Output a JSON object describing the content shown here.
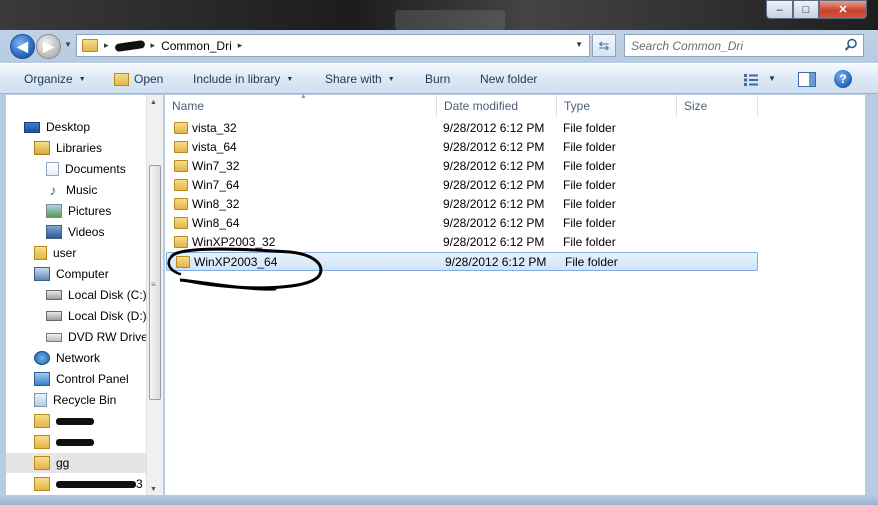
{
  "window": {
    "controls": {
      "minimize": "–",
      "maximize": "□",
      "close": "✕"
    }
  },
  "address": {
    "path_current": "Common_Dri",
    "separator": "▸"
  },
  "search": {
    "placeholder": "Search Common_Dri"
  },
  "toolbar": {
    "organize": "Organize",
    "open": "Open",
    "include_in_library": "Include in library",
    "share_with": "Share with",
    "burn": "Burn",
    "new_folder": "New folder",
    "help": "?"
  },
  "sidebar": {
    "items": [
      {
        "label": "Desktop",
        "icon": "desktop-icon"
      },
      {
        "label": "Libraries",
        "icon": "libraries-icon"
      },
      {
        "label": "Documents",
        "icon": "documents-icon"
      },
      {
        "label": "Music",
        "icon": "music-icon"
      },
      {
        "label": "Pictures",
        "icon": "pictures-icon"
      },
      {
        "label": "Videos",
        "icon": "videos-icon"
      },
      {
        "label": "user",
        "icon": "user-folder-icon"
      },
      {
        "label": "Computer",
        "icon": "computer-icon"
      },
      {
        "label": "Local Disk (C:)",
        "icon": "disk-icon"
      },
      {
        "label": "Local Disk (D:)",
        "icon": "disk-icon"
      },
      {
        "label": "DVD RW Drive (",
        "icon": "dvd-drive-icon"
      },
      {
        "label": "Network",
        "icon": "network-icon"
      },
      {
        "label": "Control Panel",
        "icon": "control-panel-icon"
      },
      {
        "label": "Recycle Bin",
        "icon": "recycle-bin-icon"
      },
      {
        "label": "",
        "icon": "folder-icon"
      },
      {
        "label": "",
        "icon": "folder-icon"
      },
      {
        "label": "gg",
        "icon": "folder-icon"
      },
      {
        "label": "3",
        "icon": "folder-icon"
      }
    ]
  },
  "columns": {
    "name": "Name",
    "date": "Date modified",
    "type": "Type",
    "size": "Size"
  },
  "files": [
    {
      "name": "vista_32",
      "date": "9/28/2012 6:12 PM",
      "type": "File folder",
      "size": ""
    },
    {
      "name": "vista_64",
      "date": "9/28/2012 6:12 PM",
      "type": "File folder",
      "size": ""
    },
    {
      "name": "Win7_32",
      "date": "9/28/2012 6:12 PM",
      "type": "File folder",
      "size": ""
    },
    {
      "name": "Win7_64",
      "date": "9/28/2012 6:12 PM",
      "type": "File folder",
      "size": ""
    },
    {
      "name": "Win8_32",
      "date": "9/28/2012 6:12 PM",
      "type": "File folder",
      "size": ""
    },
    {
      "name": "Win8_64",
      "date": "9/28/2012 6:12 PM",
      "type": "File folder",
      "size": ""
    },
    {
      "name": "WinXP2003_32",
      "date": "9/28/2012 6:12 PM",
      "type": "File folder",
      "size": ""
    },
    {
      "name": "WinXP2003_64",
      "date": "9/28/2012 6:12 PM",
      "type": "File folder",
      "size": "",
      "selected": true
    }
  ],
  "colors": {
    "selection": "#cfe5fa",
    "selection_border": "#84acdd",
    "toolbar_text": "#1e395b"
  }
}
